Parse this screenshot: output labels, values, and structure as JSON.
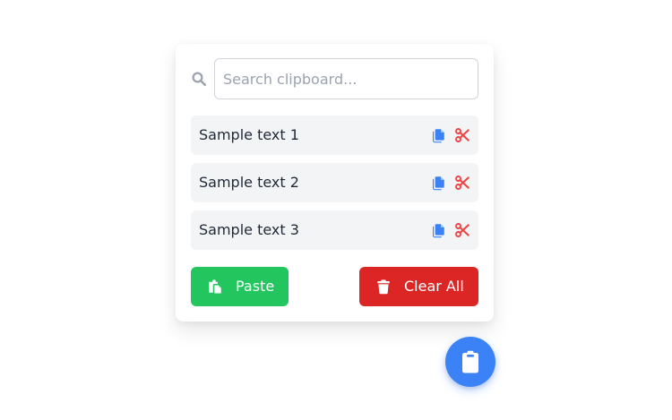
{
  "search": {
    "placeholder": "Search clipboard...",
    "value": "",
    "icon": "search-icon"
  },
  "clipboard_items": [
    {
      "text": "Sample text 1",
      "copy_icon": "copy-icon",
      "cut_icon": "cut-icon"
    },
    {
      "text": "Sample text 2",
      "copy_icon": "copy-icon",
      "cut_icon": "cut-icon"
    },
    {
      "text": "Sample text 3",
      "copy_icon": "copy-icon",
      "cut_icon": "cut-icon"
    }
  ],
  "actions": {
    "paste_label": "Paste",
    "paste_icon": "paste-icon",
    "clear_label": "Clear All",
    "clear_icon": "trash-icon"
  },
  "fab": {
    "icon": "clipboard-icon"
  },
  "colors": {
    "accent": "#3b82f6",
    "success": "#22c55e",
    "danger": "#dc2626",
    "copy_icon": "#3b82f6",
    "cut_icon": "#ef4444",
    "item_bg": "#f3f4f6",
    "muted_icon": "#9ca3af"
  }
}
